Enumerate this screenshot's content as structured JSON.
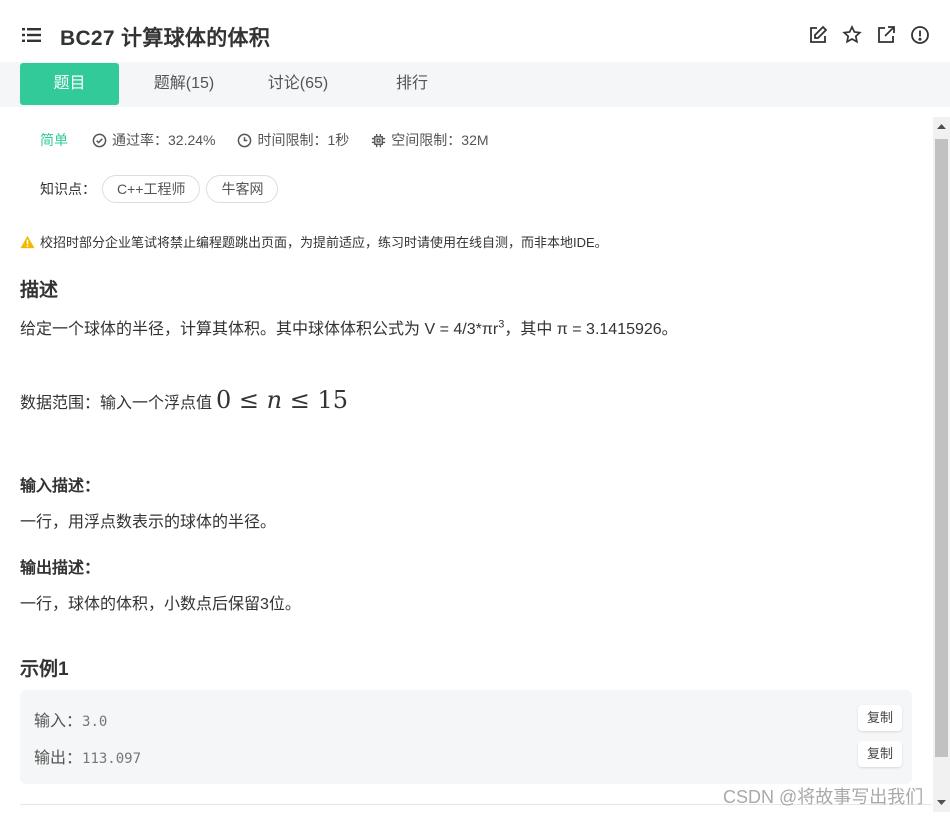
{
  "header": {
    "title": "BC27  计算球体的体积"
  },
  "tabs": [
    {
      "label": "题目",
      "active": true
    },
    {
      "label": "题解(15)"
    },
    {
      "label": "讨论(65)"
    },
    {
      "label": "排行"
    }
  ],
  "meta": {
    "difficulty": "简单",
    "pass_rate": "通过率：32.24%",
    "time_limit": "时间限制：1秒",
    "memory_limit": "空间限制：32M"
  },
  "knowledge": {
    "label": "知识点：",
    "chips": [
      "C++工程师",
      "牛客网"
    ]
  },
  "notice": "校招时部分企业笔试将禁止编程题跳出页面，为提前适应，练习时请使用在线自测，而非本地IDE。",
  "description": {
    "heading": "描述",
    "text_before": "给定一个球体的半径，计算其体积。其中球体体积公式为 V = 4/3*πr",
    "superscript": "3",
    "text_after": "，其中 π = 3.1415926。",
    "range_label": "数据范围：输入一个浮点值",
    "range_math_left": "0 ≤ ",
    "range_math_var": "n",
    "range_math_right": " ≤ 15"
  },
  "input": {
    "heading": "输入描述：",
    "text": "一行，用浮点数表示的球体的半径。"
  },
  "output": {
    "heading": "输出描述：",
    "text": "一行，球体的体积，小数点后保留3位。"
  },
  "example": {
    "heading": "示例1",
    "input_label": "输入：",
    "input_value": "3.0",
    "output_label": "输出：",
    "output_value": "113.097",
    "copy_label": "复制"
  },
  "watermark": "CSDN @将故事写出我们",
  "colors": {
    "accent": "#32ca99",
    "warning": "#f5b800"
  }
}
